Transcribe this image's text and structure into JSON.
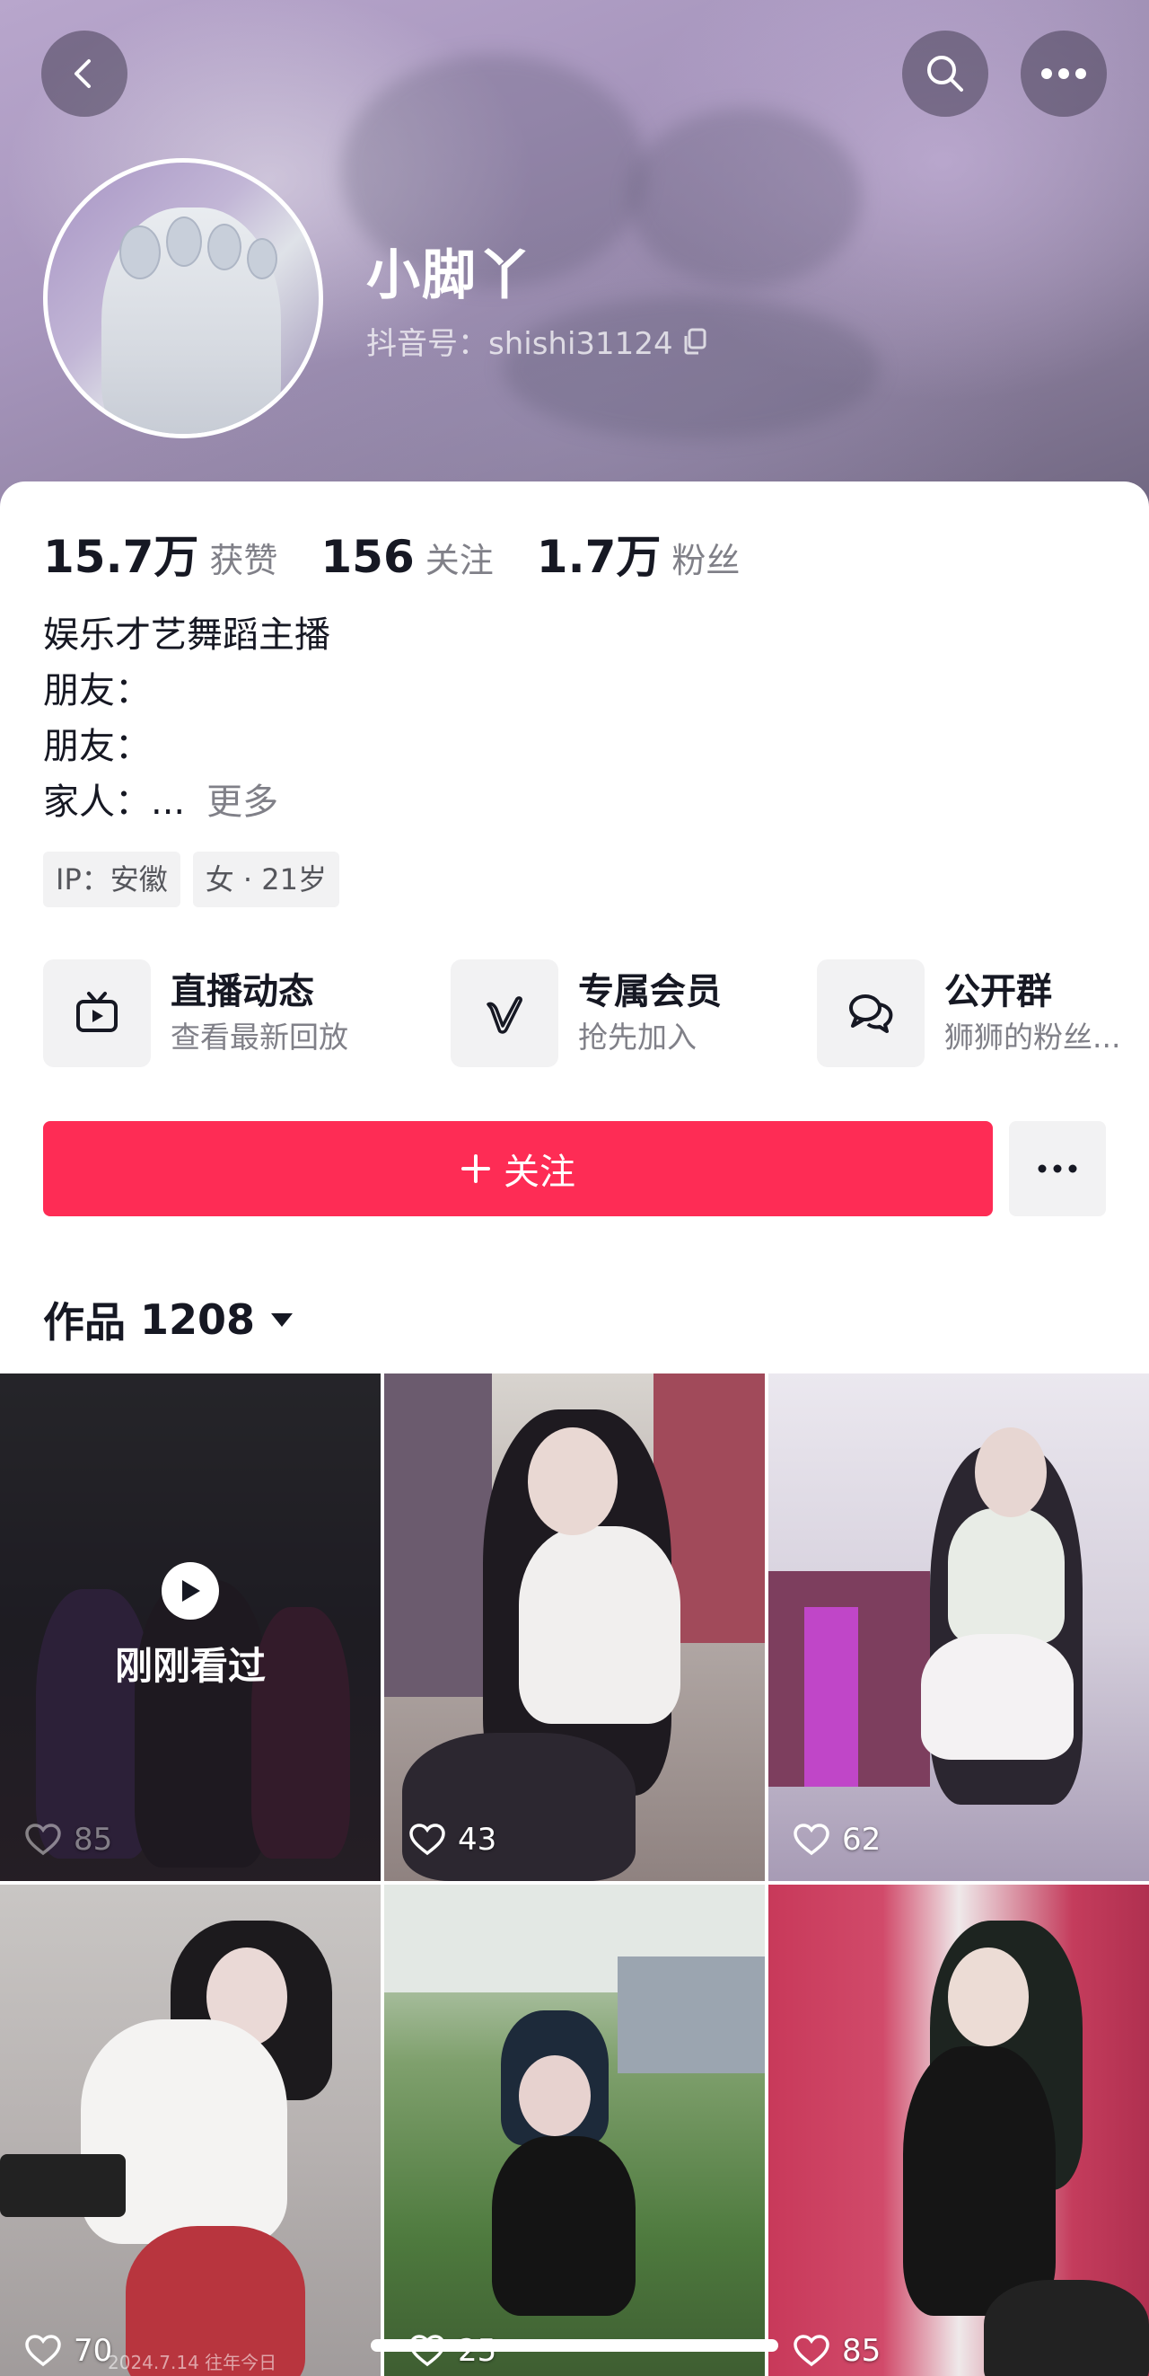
{
  "header": {
    "username": "小脚丫",
    "douyin_id": "抖音号：shishi31124"
  },
  "stats": [
    {
      "value": "15.7万",
      "label": "获赞"
    },
    {
      "value": "156",
      "label": "关注"
    },
    {
      "value": "1.7万",
      "label": "粉丝"
    }
  ],
  "bio": {
    "lines": [
      "娱乐才艺舞蹈主播",
      "朋友：",
      "朋友：",
      "家人：..."
    ],
    "more": "更多"
  },
  "tags": [
    "IP：安徽",
    "女 · 21岁"
  ],
  "features": [
    {
      "title": "直播动态",
      "subtitle": "查看最新回放",
      "icon": "tv-icon"
    },
    {
      "title": "专属会员",
      "subtitle": "抢先加入",
      "icon": "v-badge-icon"
    },
    {
      "title": "公开群",
      "subtitle": "狮狮的粉丝...",
      "icon": "chat-icon"
    }
  ],
  "actions": {
    "follow_label": "关注"
  },
  "works": {
    "label": "作品",
    "count": "1208"
  },
  "videos": [
    {
      "likes": "85",
      "overlay": "刚刚看过"
    },
    {
      "likes": "43"
    },
    {
      "likes": "62"
    },
    {
      "likes": "70"
    },
    {
      "likes": "25"
    },
    {
      "likes": "85"
    }
  ],
  "date_stamp": "2024.7.14 往年今日",
  "colors": {
    "accent": "#fe2c55",
    "text_primary": "#161823",
    "text_secondary": "#808088",
    "chip_bg": "#f2f2f3"
  }
}
